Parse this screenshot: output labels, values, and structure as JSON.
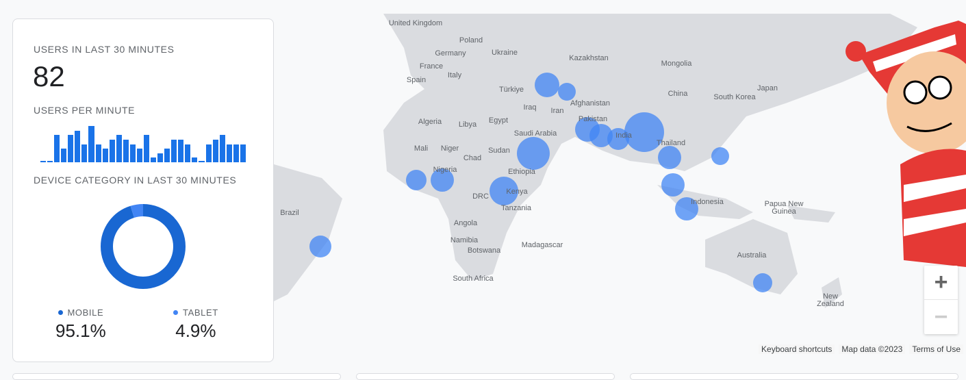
{
  "card": {
    "users_title": "USERS IN LAST 30 MINUTES",
    "users_count": "82",
    "per_minute_title": "USERS PER MINUTE",
    "per_minute_values": [
      0,
      0,
      6,
      3,
      6,
      7,
      4,
      8,
      4,
      3,
      5,
      6,
      5,
      4,
      3,
      6,
      1,
      2,
      3,
      5,
      5,
      4,
      1,
      0,
      4,
      5,
      6,
      4,
      4,
      4
    ],
    "device_title": "DEVICE CATEGORY IN LAST 30 MINUTES",
    "devices": [
      {
        "label": "MOBILE",
        "value": "95.1%",
        "share": 95.1,
        "color": "#1967d2"
      },
      {
        "label": "TABLET",
        "value": "4.9%",
        "share": 4.9,
        "color": "#4285f4"
      }
    ]
  },
  "map": {
    "labels": [
      "United Kingdom",
      "Poland",
      "Germany",
      "Ukraine",
      "France",
      "Italy",
      "Spain",
      "Türkiye",
      "Kazakhstan",
      "Mongolia",
      "China",
      "Japan",
      "South Korea",
      "Iraq",
      "Iran",
      "Afghanistan",
      "Pakistan",
      "India",
      "Thailand",
      "Algeria",
      "Libya",
      "Egypt",
      "Saudi Arabia",
      "Mali",
      "Niger",
      "Sudan",
      "Chad",
      "Nigeria",
      "Ethiopia",
      "DRC",
      "Kenya",
      "Tanzania",
      "Angola",
      "Namibia",
      "Botswana",
      "Madagascar",
      "South Africa",
      "Indonesia",
      "Papua New Guinea",
      "Australia",
      "New Zealand",
      "Brazil"
    ],
    "zoom_in": "+",
    "zoom_out": "−",
    "attribution": [
      "Keyboard shortcuts",
      "Map data ©2023",
      "Terms of Use"
    ]
  }
}
